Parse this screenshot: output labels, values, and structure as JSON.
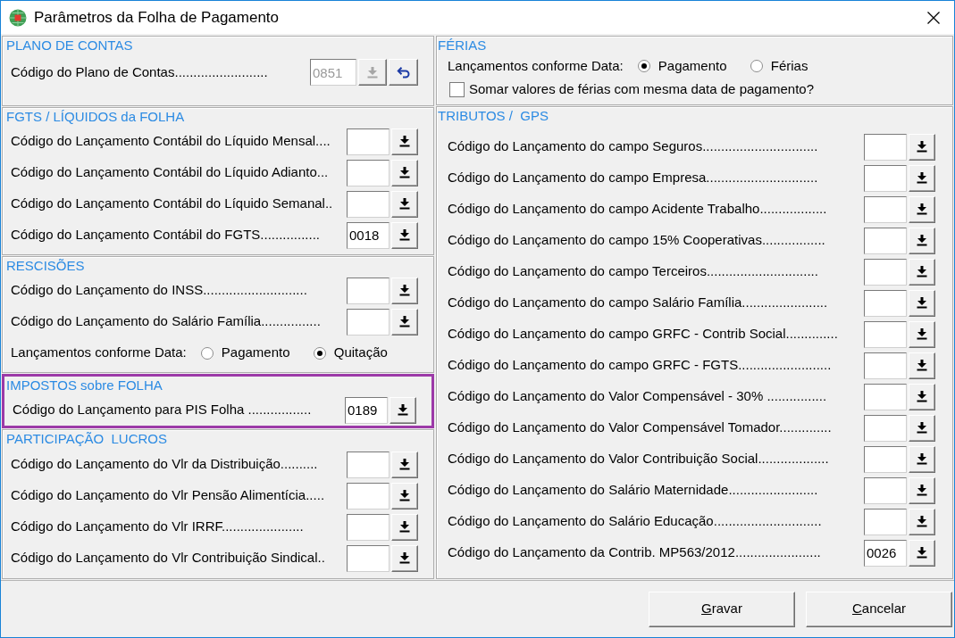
{
  "window": {
    "title": "Parâmetros da Folha de Pagamento"
  },
  "left_column": [
    {
      "title": "PLANO DE CONTAS",
      "highlighted": false,
      "rows": [
        {
          "kind": "code_with_reset",
          "label": "Código do Plano de Contas.........................",
          "value": "0851",
          "disabled": true
        }
      ]
    },
    {
      "title": "FGTS / LÍQUIDOS da FOLHA",
      "highlighted": false,
      "rows": [
        {
          "kind": "code",
          "label": "Código do Lançamento Contábil do Líquido Mensal....",
          "disabled": false
        },
        {
          "kind": "code",
          "label": "Código do Lançamento Contábil do Líquido Adianto...",
          "disabled": false
        },
        {
          "kind": "code",
          "label": "Código do Lançamento Contábil do Líquido Semanal..",
          "disabled": false
        },
        {
          "kind": "code",
          "label": "Código do Lançamento Contábil do FGTS................",
          "value": "0018",
          "disabled": false
        }
      ]
    },
    {
      "title": "RESCISÕES",
      "highlighted": false,
      "rows": [
        {
          "kind": "code",
          "label": "Código do Lançamento do INSS............................",
          "disabled": false
        },
        {
          "kind": "code",
          "label": "Código do Lançamento do Salário Família................",
          "disabled": false
        },
        {
          "kind": "radio_group",
          "label": "Lançamentos conforme Data:",
          "options": [
            {
              "label": "Pagamento",
              "selected": false
            },
            {
              "label": "Quitação",
              "selected": true
            }
          ]
        }
      ]
    },
    {
      "title": "IMPOSTOS sobre FOLHA",
      "highlighted": true,
      "rows": [
        {
          "kind": "code",
          "label": "Código do Lançamento para PIS Folha .................",
          "value": "0189",
          "disabled": false
        }
      ]
    },
    {
      "title": "PARTICIPAÇÃO  LUCROS",
      "highlighted": false,
      "rows": [
        {
          "kind": "code",
          "label": "Código do Lançamento do Vlr da Distribuição..........",
          "disabled": false
        },
        {
          "kind": "code",
          "label": "Código do Lançamento do Vlr Pensão Alimentícia.....",
          "disabled": false
        },
        {
          "kind": "code",
          "label": "Código do Lançamento do Vlr IRRF......................",
          "disabled": false
        },
        {
          "kind": "code",
          "label": "Código do Lançamento do Vlr Contribuição Sindical..",
          "disabled": false
        }
      ]
    }
  ],
  "right_column": [
    {
      "title": "FÉRIAS",
      "highlighted": false,
      "rows": [
        {
          "kind": "radio_group",
          "label": "Lançamentos conforme Data:",
          "options": [
            {
              "label": "Pagamento",
              "selected": true
            },
            {
              "label": "Férias",
              "selected": false
            }
          ]
        },
        {
          "kind": "checkbox",
          "label": "Somar valores de férias com mesma data de pagamento?",
          "checked": false
        }
      ]
    },
    {
      "title": "TRIBUTOS /  GPS",
      "highlighted": false,
      "rows": [
        {
          "kind": "code",
          "label": "Código do Lançamento do campo Seguros...............................",
          "disabled": false
        },
        {
          "kind": "code",
          "label": "Código do Lançamento do campo Empresa..............................",
          "disabled": false
        },
        {
          "kind": "code",
          "label": "Código do Lançamento do campo Acidente Trabalho..................",
          "disabled": false
        },
        {
          "kind": "code",
          "label": "Código do Lançamento do campo 15% Cooperativas.................",
          "disabled": false
        },
        {
          "kind": "code",
          "label": "Código do Lançamento do campo Terceiros..............................",
          "disabled": false
        },
        {
          "kind": "code",
          "label": "Código do Lançamento do campo Salário Família.......................",
          "disabled": false
        },
        {
          "kind": "code",
          "label": "Código do Lançamento do campo GRFC - Contrib Social..............",
          "disabled": false
        },
        {
          "kind": "code",
          "label": "Código do Lançamento do campo GRFC - FGTS.........................",
          "disabled": false
        },
        {
          "kind": "code",
          "label": "Código do Lançamento do Valor Compensável - 30% ................",
          "disabled": false
        },
        {
          "kind": "code",
          "label": "Código do Lançamento do Valor Compensável Tomador..............",
          "disabled": false
        },
        {
          "kind": "code",
          "label": "Código do Lançamento do Valor Contribuição Social...................",
          "disabled": false
        },
        {
          "kind": "code",
          "label": "Código do Lançamento do Salário Maternidade........................",
          "disabled": false
        },
        {
          "kind": "code",
          "label": "Código do Lançamento do Salário Educação.............................",
          "disabled": false
        },
        {
          "kind": "code",
          "label": "Código do Lançamento da Contrib. MP563/2012.......................",
          "value": "0026",
          "disabled": false
        }
      ]
    }
  ],
  "buttons": [
    {
      "label": "Gravar",
      "mnemonic": true
    },
    {
      "label": "Cancelar",
      "mnemonic": true
    }
  ]
}
